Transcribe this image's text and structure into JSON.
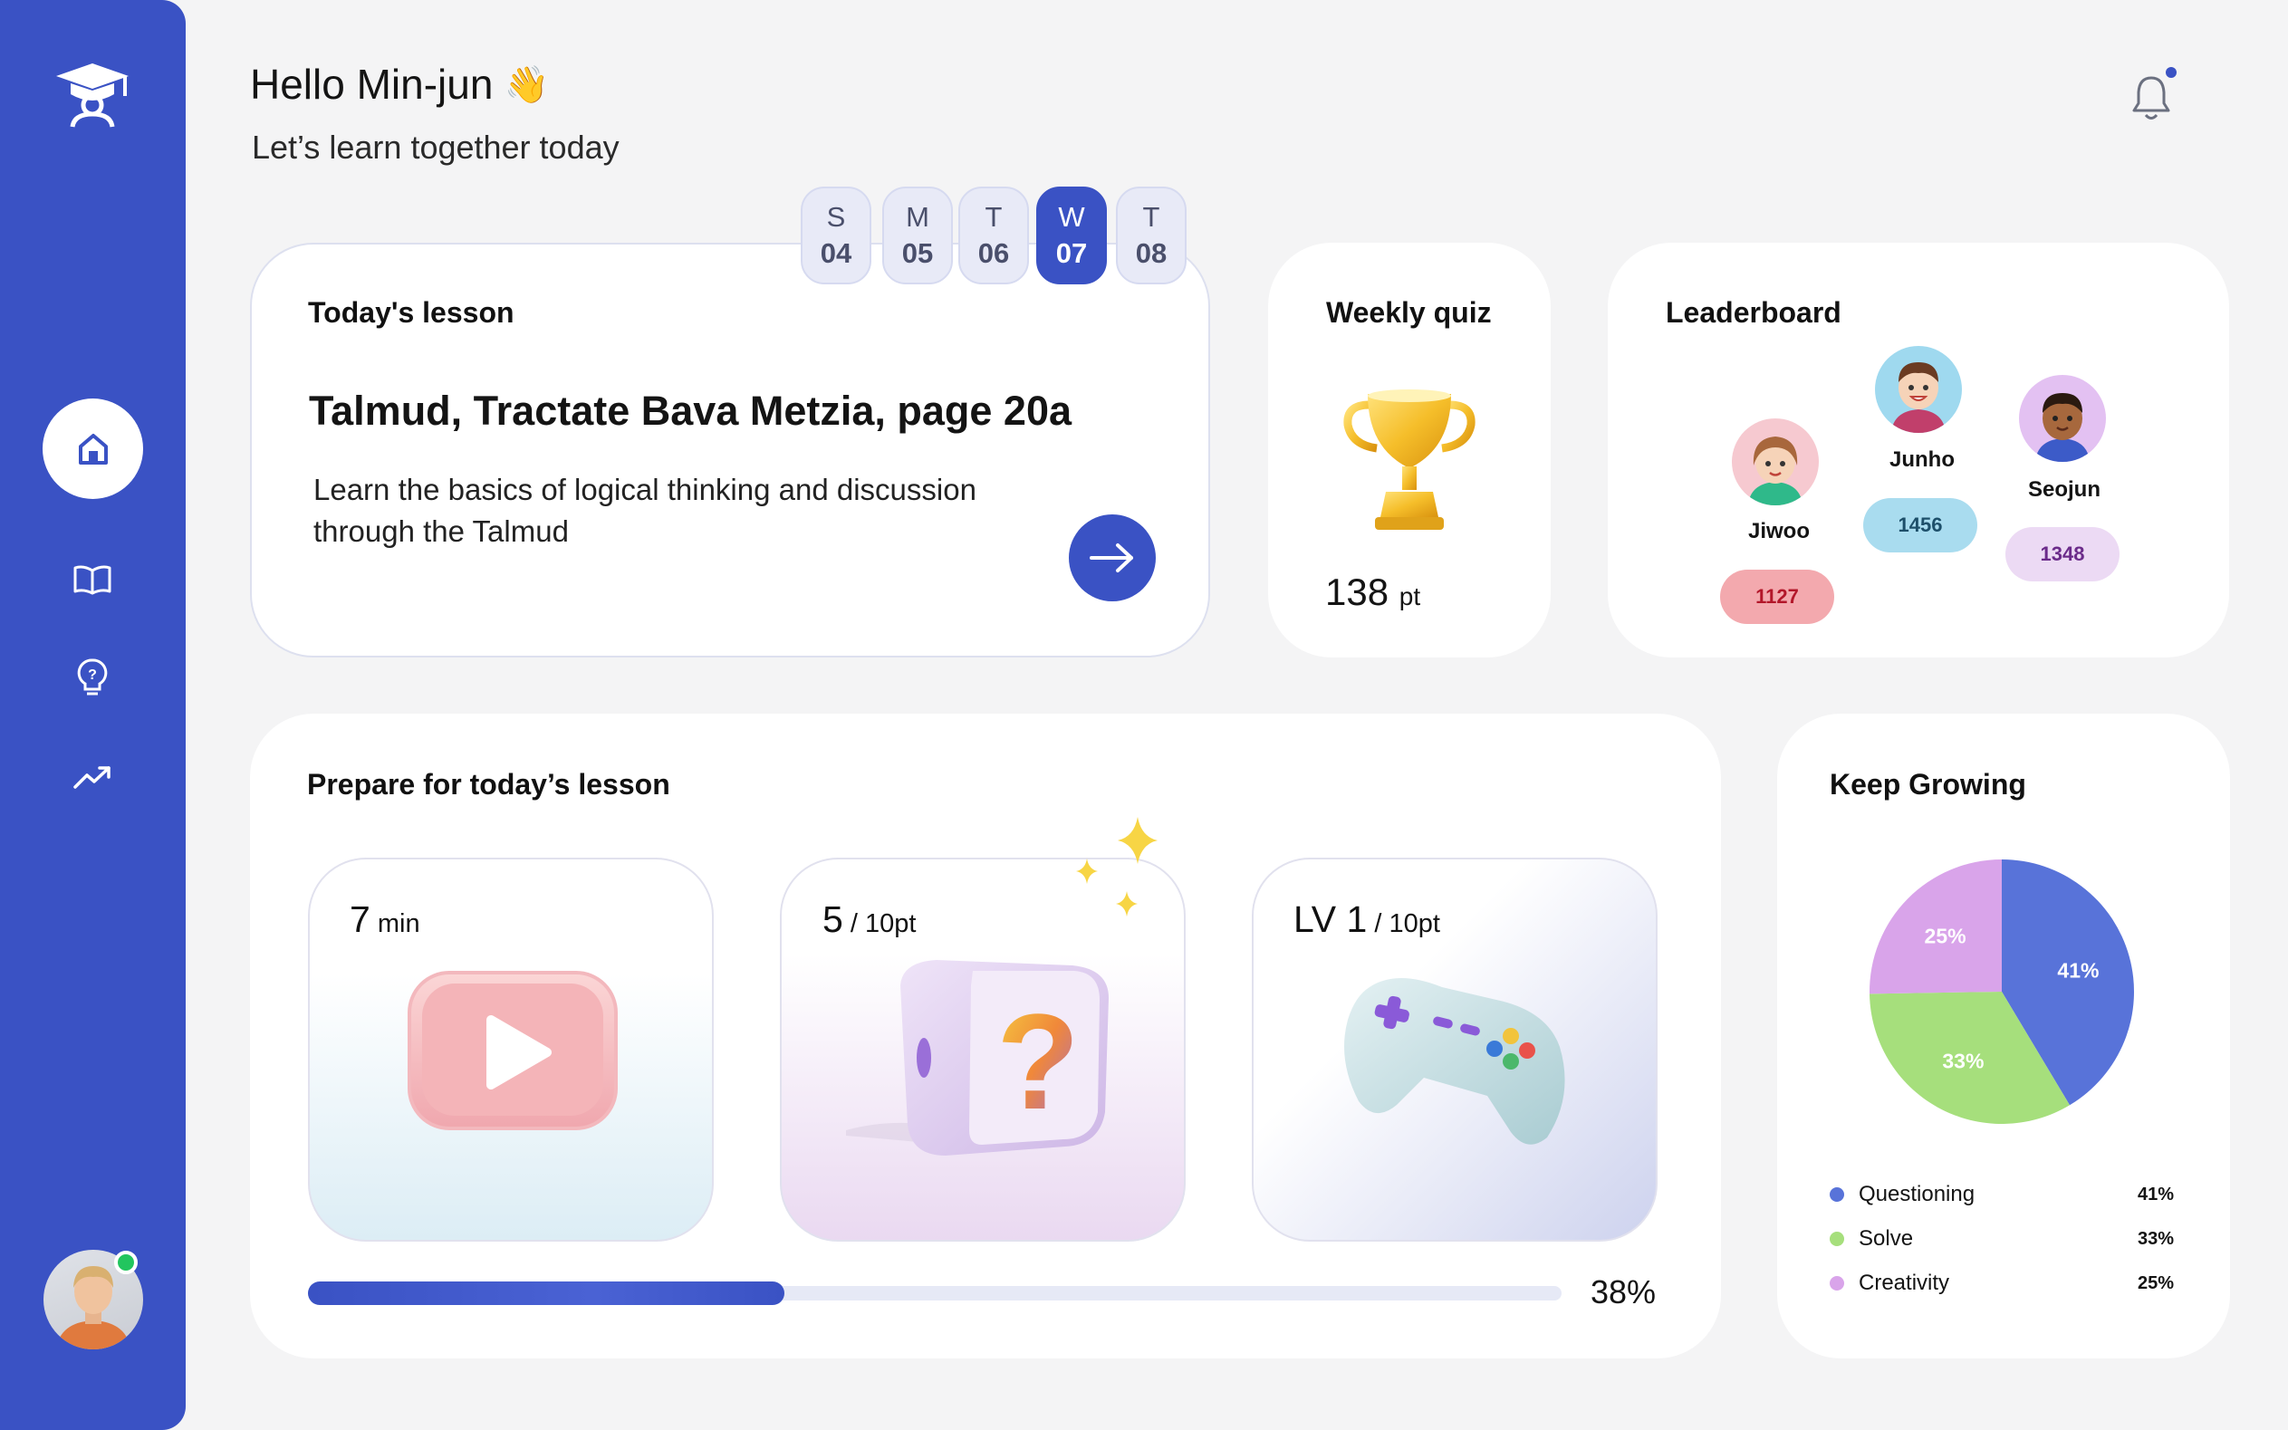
{
  "header": {
    "greeting": "Hello Min-jun",
    "wave": "👋",
    "subtitle": "Let’s learn together today"
  },
  "sidebar": {
    "items": [
      {
        "icon": "home-icon",
        "active": true
      },
      {
        "icon": "book-icon",
        "active": false
      },
      {
        "icon": "lightbulb-icon",
        "active": false
      },
      {
        "icon": "trending-up-icon",
        "active": false
      }
    ],
    "accent": "#3a52c4"
  },
  "days": [
    {
      "letter": "S",
      "num": "04",
      "active": false
    },
    {
      "letter": "M",
      "num": "05",
      "active": false
    },
    {
      "letter": "T",
      "num": "06",
      "active": false
    },
    {
      "letter": "W",
      "num": "07",
      "active": true
    },
    {
      "letter": "T",
      "num": "08",
      "active": false
    }
  ],
  "lesson": {
    "heading": "Today's lesson",
    "title": "Talmud, Tractate Bava Metzia, page 20a",
    "description": "Learn the basics of logical thinking and discussion through the Talmud"
  },
  "quiz": {
    "heading": "Weekly quiz",
    "points": "138",
    "unit": "pt"
  },
  "leaderboard": {
    "heading": "Leaderboard",
    "players": [
      {
        "name": "Jiwoo",
        "score": "1127",
        "pill": "#f3a9ae",
        "pill_text": "#b3172a"
      },
      {
        "name": "Junho",
        "score": "1456",
        "pill": "#a9dcef",
        "pill_text": "#1d4f6a"
      },
      {
        "name": "Seojun",
        "score": "1348",
        "pill": "#ecdaf4",
        "pill_text": "#6b2b8a"
      }
    ]
  },
  "prepare": {
    "heading": "Prepare for today’s lesson",
    "tiles": [
      {
        "value": "7",
        "unit": " min",
        "icon": "video-play-icon"
      },
      {
        "value": "5",
        "unit": " / 10pt",
        "icon": "quiz-box-icon"
      },
      {
        "value": "LV 1",
        "unit": " / 10pt",
        "icon": "game-controller-icon"
      }
    ],
    "progress": 0.38,
    "progress_label": "38%"
  },
  "growth": {
    "heading": "Keep Growing",
    "legend": [
      {
        "label": "Questioning",
        "value": "41%",
        "color": "#5873d9"
      },
      {
        "label": "Solve",
        "value": "33%",
        "color": "#a6df7c"
      },
      {
        "label": "Creativity",
        "value": "25%",
        "color": "#d9a4ea"
      }
    ]
  },
  "chart_data": {
    "type": "pie",
    "categories": [
      "Questioning",
      "Solve",
      "Creativity"
    ],
    "values": [
      41,
      33,
      25
    ],
    "labels": [
      "41%",
      "33%",
      "25%"
    ],
    "colors": [
      "#5873d9",
      "#a6df7c",
      "#d9a4ea"
    ],
    "title": "Keep Growing"
  }
}
